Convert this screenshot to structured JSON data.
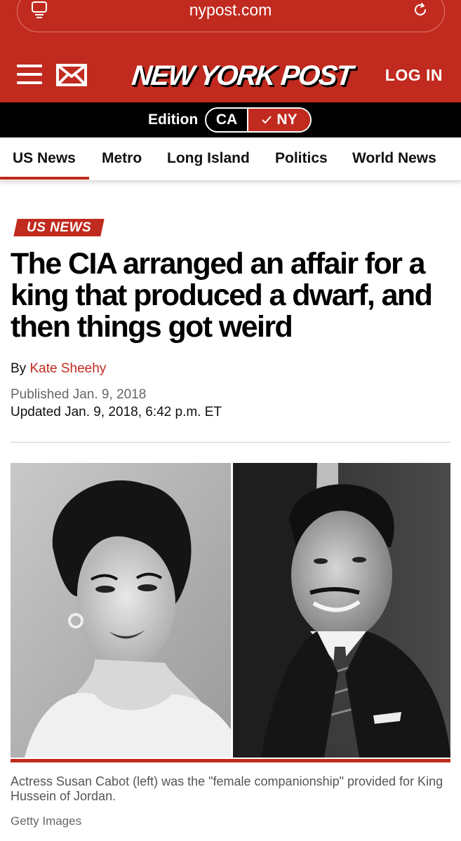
{
  "browser": {
    "url": "nypost.com"
  },
  "header": {
    "logo_text": "NEW YORK POST",
    "login_label": "LOG IN"
  },
  "edition": {
    "label": "Edition",
    "options": [
      "CA",
      "NY"
    ],
    "selected": "NY"
  },
  "nav": {
    "items": [
      "US News",
      "Metro",
      "Long Island",
      "Politics",
      "World News"
    ],
    "active": "US News"
  },
  "article": {
    "kicker": "US NEWS",
    "headline": "The CIA arranged an affair for a king that produced a dwarf, and then things got weird",
    "byline_prefix": "By",
    "author": "Kate Sheehy",
    "published": "Published Jan. 9, 2018",
    "updated": "Updated Jan. 9, 2018, 6:42 p.m. ET",
    "caption": "Actress Susan Cabot (left) was the \"female companionship\" provided for King Hussein of Jordan.",
    "credit": "Getty Images"
  },
  "colors": {
    "brand_red": "#c12a1e",
    "edition_bar": "#000000"
  },
  "icons": [
    "tab-icon",
    "reload-icon",
    "menu-icon",
    "mail-icon",
    "checkmark-icon"
  ]
}
